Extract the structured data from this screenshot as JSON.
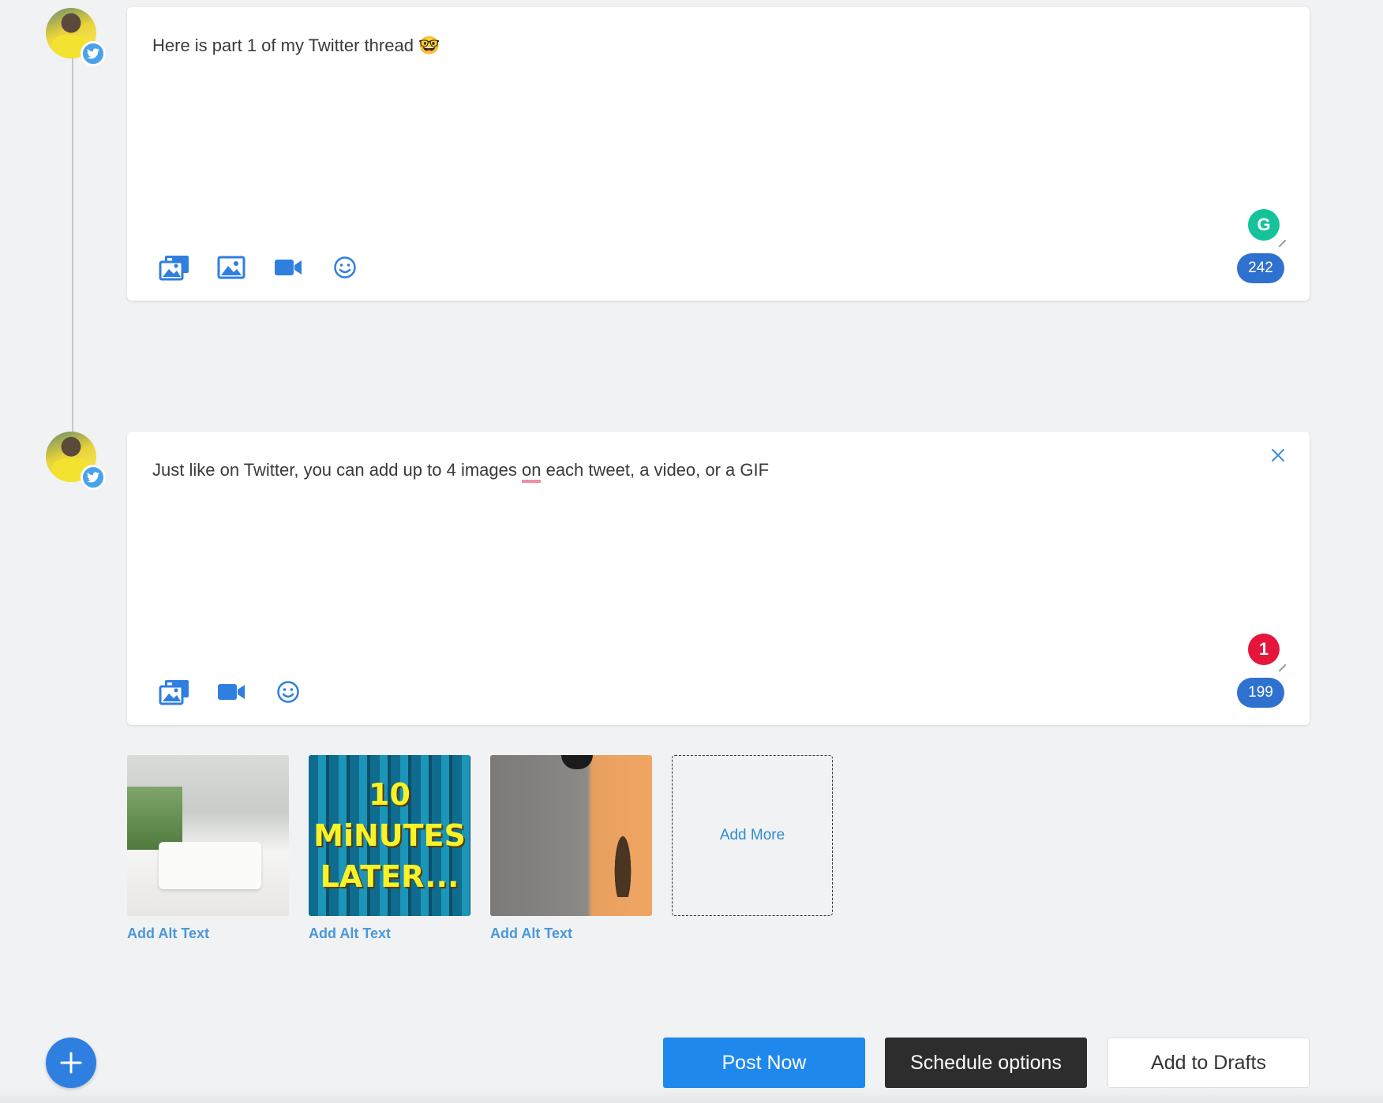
{
  "colors": {
    "accent": "#2f71cf",
    "post_button": "#1f88ec",
    "schedule_button": "#2d2d2d",
    "twitter_badge": "#4aa3e8",
    "grammarly_green": "#15c39a",
    "error_red": "#e5163c",
    "link_blue": "#4b98d8"
  },
  "tweets": [
    {
      "text": "Here is part 1 of my Twitter thread 🤓",
      "char_count": "242",
      "icons": [
        "gallery-icon",
        "image-icon",
        "video-icon",
        "emoji-icon"
      ],
      "assistant_badge": "G"
    },
    {
      "text_before": "Just like on Twitter, you can add up to 4 images ",
      "text_mark": "on",
      "text_after": " each tweet, a video, or a GIF",
      "char_count": "199",
      "icons": [
        "gallery-icon",
        "video-icon",
        "emoji-icon"
      ],
      "assistant_badge": "1"
    }
  ],
  "media": {
    "thumbnails": [
      {
        "name": "bedroom-image",
        "alt_link": "Add Alt Text"
      },
      {
        "name": "ten-minutes-later-image",
        "alt_link": "Add Alt Text",
        "caption_lines": [
          "10",
          "MiNUTES",
          "LATER..."
        ]
      },
      {
        "name": "wall-shadow-image",
        "alt_link": "Add Alt Text"
      }
    ],
    "add_more_label": "Add More"
  },
  "actions": {
    "post_now": "Post Now",
    "schedule_options": "Schedule options",
    "add_to_drafts": "Add to Drafts"
  }
}
